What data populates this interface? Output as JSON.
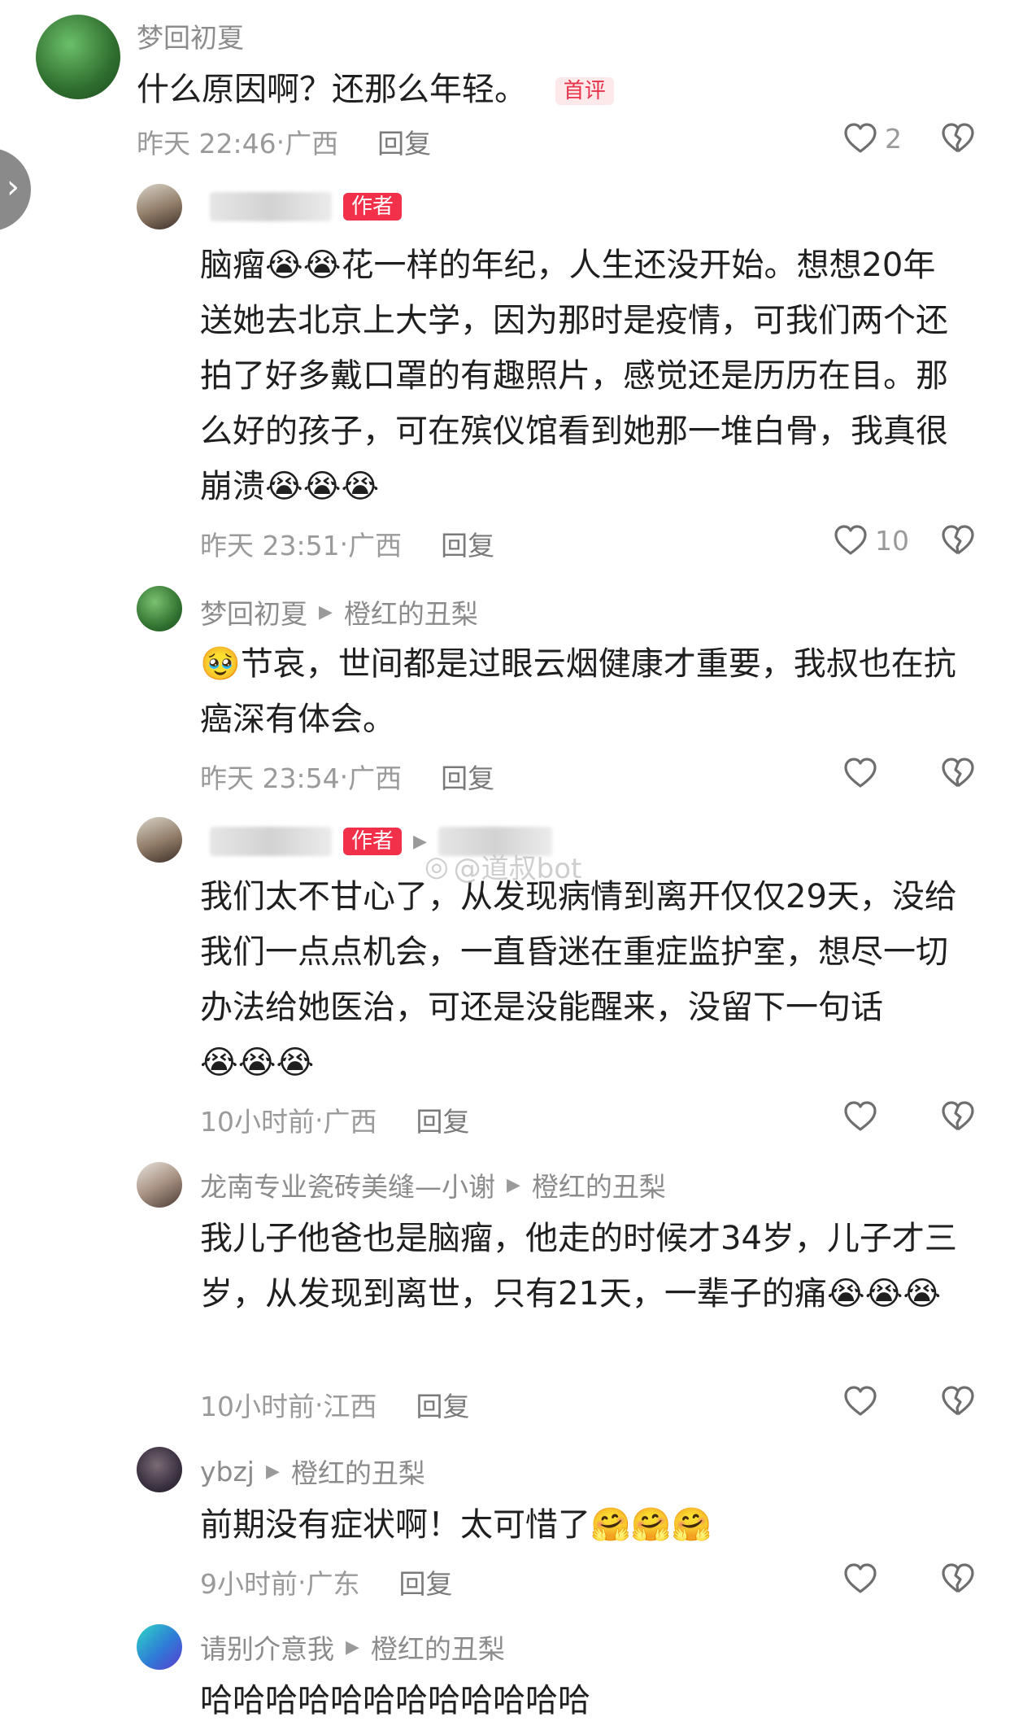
{
  "colors": {
    "author_badge": "#f2304a",
    "first_badge_bg": "#fde8ea",
    "first_badge_text": "#e8334a",
    "muted": "#9a9a9a"
  },
  "icons": {
    "like": "heart-outline-icon",
    "dislike": "broken-heart-icon",
    "side_tab": "chevron-right-icon",
    "cry": "loudly-crying-face",
    "hug": "hugging-face",
    "tears": "face-holding-back-tears"
  },
  "watermark": "@道叔bot",
  "comments": [
    {
      "name": "梦回初夏",
      "badge": "首评",
      "text": "什么原因啊？还那么年轻。",
      "time": "昨天 22:46",
      "location": "广西",
      "reply_label": "回复",
      "likes": "2"
    },
    {
      "badge": "作者",
      "text_a": "脑瘤",
      "text_b": "花一样的年纪，人生还没开始。想想20年送她去北京上大学，因为那时是疫情，可我们两个还拍了好多戴口罩的有趣照片，感觉还是历历在目。那么好的孩子，可在殡仪馆看到她那一堆白骨，我真很崩溃",
      "time": "昨天 23:51",
      "location": "广西",
      "reply_label": "回复",
      "likes": "10"
    },
    {
      "name": "梦回初夏",
      "reply_to": "橙红的丑梨",
      "text": "节哀，世间都是过眼云烟健康才重要，我叔也在抗癌深有体会。",
      "time": "昨天 23:54",
      "location": "广西",
      "reply_label": "回复",
      "likes": ""
    },
    {
      "badge": "作者",
      "text": "我们太不甘心了，从发现病情到离开仅仅29天，没给我们一点点机会，一直昏迷在重症监护室，想尽一切办法给她医治，可还是没能醒来，没留下一句话",
      "time": "10小时前",
      "location": "广西",
      "reply_label": "回复",
      "likes": ""
    },
    {
      "name": "龙南专业瓷砖美缝—小谢",
      "reply_to": "橙红的丑梨",
      "text": "我儿子他爸也是脑瘤，他走的时候才34岁，儿子才三岁，从发现到离世，只有21天，一辈子的痛",
      "time": "10小时前",
      "location": "江西",
      "reply_label": "回复",
      "likes": ""
    },
    {
      "name": "ybzj",
      "reply_to": "橙红的丑梨",
      "text": "前期没有症状啊！太可惜了",
      "time": "9小时前",
      "location": "广东",
      "reply_label": "回复",
      "likes": ""
    },
    {
      "name": "请别介意我",
      "reply_to": "橙红的丑梨",
      "text": "哈哈哈哈哈哈哈哈哈哈哈哈"
    }
  ]
}
